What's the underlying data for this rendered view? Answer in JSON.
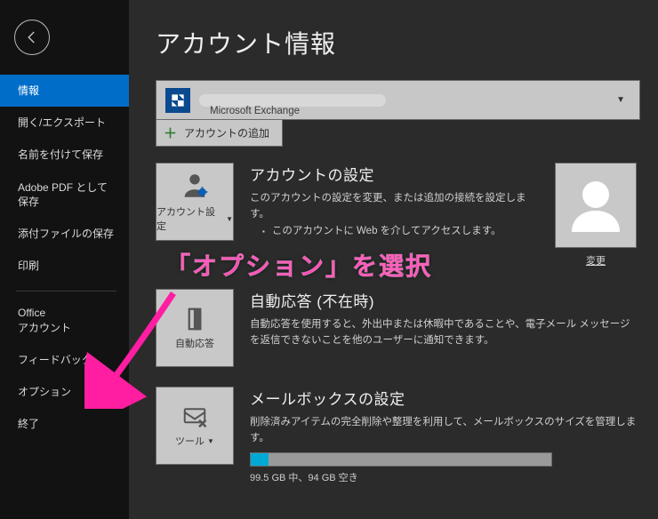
{
  "sidebar": {
    "items": [
      {
        "label": "情報",
        "active": true
      },
      {
        "label": "開く/エクスポート"
      },
      {
        "label": "名前を付けて保存"
      },
      {
        "label": "Adobe PDF として保存"
      },
      {
        "label": "添付ファイルの保存"
      },
      {
        "label": "印刷"
      }
    ],
    "items2": [
      {
        "label": "Office\nアカウント"
      },
      {
        "label": "フィードバック"
      },
      {
        "label": "オプション"
      },
      {
        "label": "終了"
      }
    ]
  },
  "page": {
    "title": "アカウント情報",
    "account_type": "Microsoft Exchange",
    "add_account": "アカウントの追加"
  },
  "account_settings": {
    "tile_label": "アカウント設定",
    "title": "アカウントの設定",
    "desc": "このアカウントの設定を変更、または追加の接続を設定します。",
    "bullet": "このアカウントに Web を介してアクセスします。",
    "avatar_change": "変更"
  },
  "auto_reply": {
    "tile_label": "自動応答",
    "title": "自動応答 (不在時)",
    "desc": "自動応答を使用すると、外出中または休暇中であることや、電子メール メッセージを返信できないことを他のユーザーに通知できます。"
  },
  "mailbox": {
    "tile_label": "ツール",
    "title": "メールボックスの設定",
    "desc": "削除済みアイテムの完全削除や整理を利用して、メールボックスのサイズを管理します。",
    "storage_text": "99.5 GB 中、94 GB 空き"
  },
  "annotation": {
    "text": "「オプション」を選択"
  }
}
